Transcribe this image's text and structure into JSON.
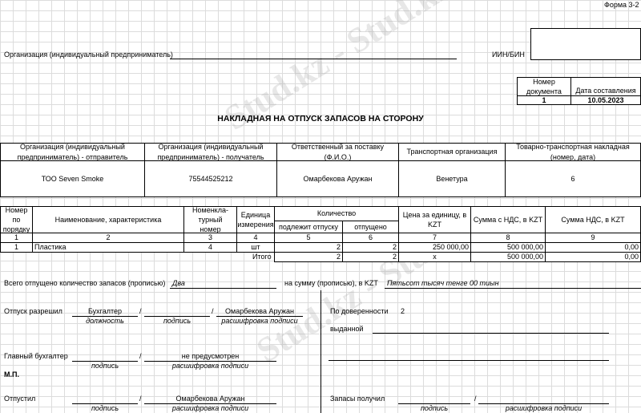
{
  "form_number": "Форма 3-2",
  "org_label": "Организация (индивидуальный предприниматель)",
  "iin_label": "ИИН/БИН",
  "doc": {
    "number_header": "Номер документа",
    "date_header": "Дата составления",
    "number": "1",
    "date": "10.05.2023"
  },
  "title": "НАКЛАДНАЯ НА ОТПУСК ЗАПАСОВ НА СТОРОНУ",
  "parties": {
    "headers": [
      "Организация (индивидуальный предприниматель) - отправитель",
      "Организация (индивидуальный предприниматель) - получатель",
      "Ответственный за поставку (Ф.И.О.)",
      "Транспортная организация",
      "Товарно-транспортная накладная (номер, дата)"
    ],
    "values": [
      "ТОО Seven Smoke",
      "75544525212",
      "Омарбекова Аружан",
      "Венетура",
      "6"
    ]
  },
  "items": {
    "headers": {
      "num": "Номер по порядку",
      "name": "Наименование, характеристика",
      "nomen": "Номенкла-турный номер",
      "unit": "Единица измерения",
      "qty": "Количество",
      "qty_due": "подлежит отпуску",
      "qty_rel": "отпущено",
      "price": "Цена за единицу, в KZT",
      "sum": "Сумма с НДС, в KZT",
      "vat": "Сумма НДС, в KZT"
    },
    "col_numbers": [
      "1",
      "2",
      "3",
      "4",
      "5",
      "6",
      "7",
      "8",
      "9"
    ],
    "rows": [
      {
        "num": "1",
        "name": "Пластика",
        "nomen": "4",
        "unit": "шт",
        "due": "2",
        "rel": "2",
        "price": "250 000,00",
        "sum": "500 000,00",
        "vat": "0,00"
      }
    ],
    "total": {
      "label": "Итого",
      "due": "2",
      "rel": "2",
      "price": "x",
      "sum": "500 000,00",
      "vat": "0,00"
    }
  },
  "summary": {
    "qty_label": "Всего отпущено количество запасов (прописью)",
    "qty_value": "Два",
    "sum_label": "на сумму (прописью), в KZT",
    "sum_value": "Пятьсот тысяч тенге 00 тиын"
  },
  "signatures": {
    "allowed_label": "Отпуск разрешил",
    "allowed_position": "Бухгалтер",
    "allowed_name": "Омарбекова Аружан",
    "chief_label": "Главный бухгалтер",
    "chief_name": "не предусмотрен",
    "stamp": "М.П.",
    "released_label": "Отпустил",
    "released_name": "Омарбекова Аружан",
    "received_label": "Запасы получил",
    "proxy_label": "По доверенности",
    "proxy_value": "2",
    "issued_label": "выданной",
    "caption_position": "должность",
    "caption_signature": "подпись",
    "caption_decoding": "расшифровка подписи",
    "slash": "/"
  },
  "watermark": "Stud.kz - Stud.kz"
}
